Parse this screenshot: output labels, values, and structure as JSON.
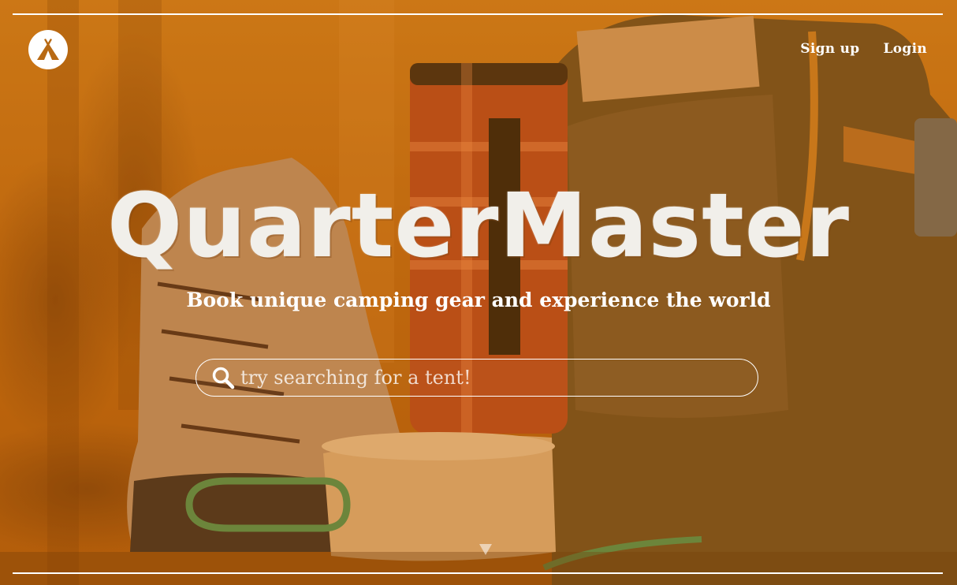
{
  "brand": {
    "title": "QuarterMaster",
    "tagline": "Book unique camping gear and experience the world",
    "logo_icon": "tent-icon"
  },
  "nav": {
    "signup_label": "Sign up",
    "login_label": "Login"
  },
  "search": {
    "placeholder": "try searching for a tent!",
    "value": "",
    "icon": "search-icon"
  },
  "colors": {
    "overlay": "#c16a12",
    "text": "#ffffff"
  }
}
